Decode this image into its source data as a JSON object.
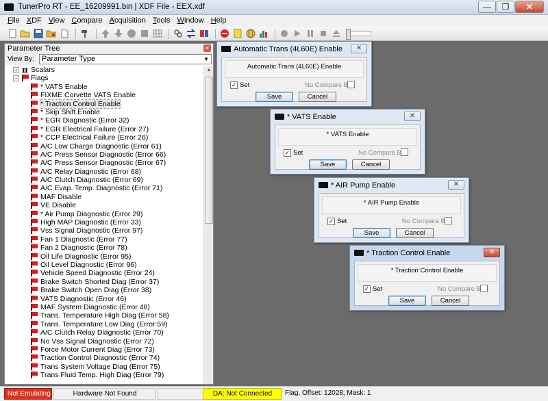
{
  "window": {
    "title": "TunerPro RT - EE_16209991.bin | XDF File - EEX.xdf",
    "minimize": "—",
    "restore": "❐",
    "close": "✕"
  },
  "menu": [
    {
      "label": "File",
      "key": "F"
    },
    {
      "label": "XDF",
      "key": "X"
    },
    {
      "label": "View",
      "key": "V"
    },
    {
      "label": "Compare",
      "key": "C"
    },
    {
      "label": "Acquisition",
      "key": "A"
    },
    {
      "label": "Tools",
      "key": "T"
    },
    {
      "label": "Window",
      "key": "W"
    },
    {
      "label": "Help",
      "key": "H"
    }
  ],
  "toolbar": {
    "icons": [
      "new-file-icon",
      "open-folder-icon",
      "save-icon",
      "open-xdf-icon",
      "new-document-icon",
      "hammer-icon",
      "arrow-up-icon",
      "arrow-down-icon",
      "circle-icon",
      "stop-icon",
      "grid-icon",
      "link-icon",
      "swap-icon",
      "compare-icon",
      "no-entry-icon",
      "note-icon",
      "globe-icon",
      "bar-chart-icon",
      "record-icon",
      "play-icon",
      "pause-icon",
      "stop-playback-icon",
      "eject-icon"
    ]
  },
  "tree_panel": {
    "title": "Parameter Tree",
    "close": "✕",
    "view_by_label": "View By:",
    "view_by_value": "Parameter Type",
    "items": [
      {
        "label": "Scalars",
        "level": 0,
        "icon": "pi-icon",
        "expander": "+"
      },
      {
        "label": "Flags",
        "level": 0,
        "icon": "folder-icon",
        "expander": "−"
      },
      {
        "label": "* VATS Enable",
        "level": 1
      },
      {
        "label": "FIXME Corvette VATS Enable",
        "level": 1
      },
      {
        "label": "* Traction Control Enable",
        "level": 1,
        "selected": true
      },
      {
        "label": "* Skip Shift Enable",
        "level": 1
      },
      {
        "label": "* EGR Diagnostic (Error 32)",
        "level": 1
      },
      {
        "label": "* EGR Electrical Failure (Error 27)",
        "level": 1
      },
      {
        "label": "* CCP Electrical Failure (Error 26)",
        "level": 1
      },
      {
        "label": "A/C Low Charge Diagnostic (Error 61)",
        "level": 1
      },
      {
        "label": "A/C Press Sensor Diagnostic (Error 66)",
        "level": 1
      },
      {
        "label": "A/C Press Sensor Diagnostic (Error 67)",
        "level": 1
      },
      {
        "label": "A/C Relay Diagnostic (Error 68)",
        "level": 1
      },
      {
        "label": "A/C Clutch Diagnostic (Error 69)",
        "level": 1
      },
      {
        "label": "A/C Evap. Temp. Diagnostic (Error 71)",
        "level": 1
      },
      {
        "label": "MAF Disable",
        "level": 1
      },
      {
        "label": "VE Disable",
        "level": 1
      },
      {
        "label": "* Air Pump Diagnostic (Error 29)",
        "level": 1
      },
      {
        "label": "High MAP Diagnostic (Error 33)",
        "level": 1
      },
      {
        "label": "Vss Signal Diagnostic (Error 97)",
        "level": 1
      },
      {
        "label": "Fan 1 Diagnostic (Error 77)",
        "level": 1
      },
      {
        "label": "Fan 2 Diagnostic (Error 78)",
        "level": 1
      },
      {
        "label": "Oil Life Diagnostic (Error 95)",
        "level": 1
      },
      {
        "label": "Oil Level Diagnostic (Error 96)",
        "level": 1
      },
      {
        "label": "Vehicle Speed Diagnostic (Error 24)",
        "level": 1
      },
      {
        "label": "Brake Switch Shorted Diag (Error 37)",
        "level": 1
      },
      {
        "label": "Brake Switch Open Diag (Error 38)",
        "level": 1
      },
      {
        "label": "VATS Diagnostic (Error 46)",
        "level": 1
      },
      {
        "label": "MAF System Diagnostic (Error 48)",
        "level": 1
      },
      {
        "label": "Trans. Temperature High Diag (Error 58)",
        "level": 1
      },
      {
        "label": "Trans. Temperature Low Diag (Error 59)",
        "level": 1
      },
      {
        "label": "A/C Clutch Relay Diagnostic (Error 70)",
        "level": 1
      },
      {
        "label": "No Vss Signal Diagnostic (Error 72)",
        "level": 1
      },
      {
        "label": "Force Motor Current Diag (Error 73)",
        "level": 1
      },
      {
        "label": "Traction Control Diagnostic (Error 74)",
        "level": 1
      },
      {
        "label": "Trans System Voltage Diag (Error 75)",
        "level": 1
      },
      {
        "label": "Trans Fluid Temp. High Diag (Error 79)",
        "level": 1
      }
    ]
  },
  "dialogs": [
    {
      "id": "auto-trans",
      "title": "Automatic Trans (4L60E) Enable",
      "description": "Automatic Trans (4L60E) Enable",
      "set_label": "Set",
      "set_checked": true,
      "no_compare_label": "No Compare Bin",
      "no_compare_checked": false,
      "save": "Save",
      "cancel": "Cancel",
      "close": "✕",
      "active": false
    },
    {
      "id": "vats",
      "title": "* VATS Enable",
      "description": "* VATS Enable",
      "set_label": "Set",
      "set_checked": true,
      "no_compare_label": "No Compare Bin",
      "no_compare_checked": false,
      "save": "Save",
      "cancel": "Cancel",
      "close": "✕",
      "active": false
    },
    {
      "id": "air-pump",
      "title": "* AIR Pump Enable",
      "description": "* AIR Pump Enable",
      "set_label": "Set",
      "set_checked": true,
      "no_compare_label": "No Compare Bin",
      "no_compare_checked": false,
      "save": "Save",
      "cancel": "Cancel",
      "close": "✕",
      "active": false
    },
    {
      "id": "traction",
      "title": "* Traction Control Enable",
      "description": "* Traction Control Enable",
      "set_label": "Set",
      "set_checked": true,
      "no_compare_label": "No Compare Bin",
      "no_compare_checked": false,
      "save": "Save",
      "cancel": "Cancel",
      "close": "✕",
      "active": true
    }
  ],
  "status": {
    "emulation": "Not Emulating",
    "hardware": "Hardware Not Found",
    "da": "DA: Not Connected",
    "info": "Flag, Offset: 12028,  Mask: 1"
  },
  "colors": {
    "emulation_bg": "#e0301e",
    "da_bg": "#ffff00",
    "flag_red": "#d41f1f"
  }
}
